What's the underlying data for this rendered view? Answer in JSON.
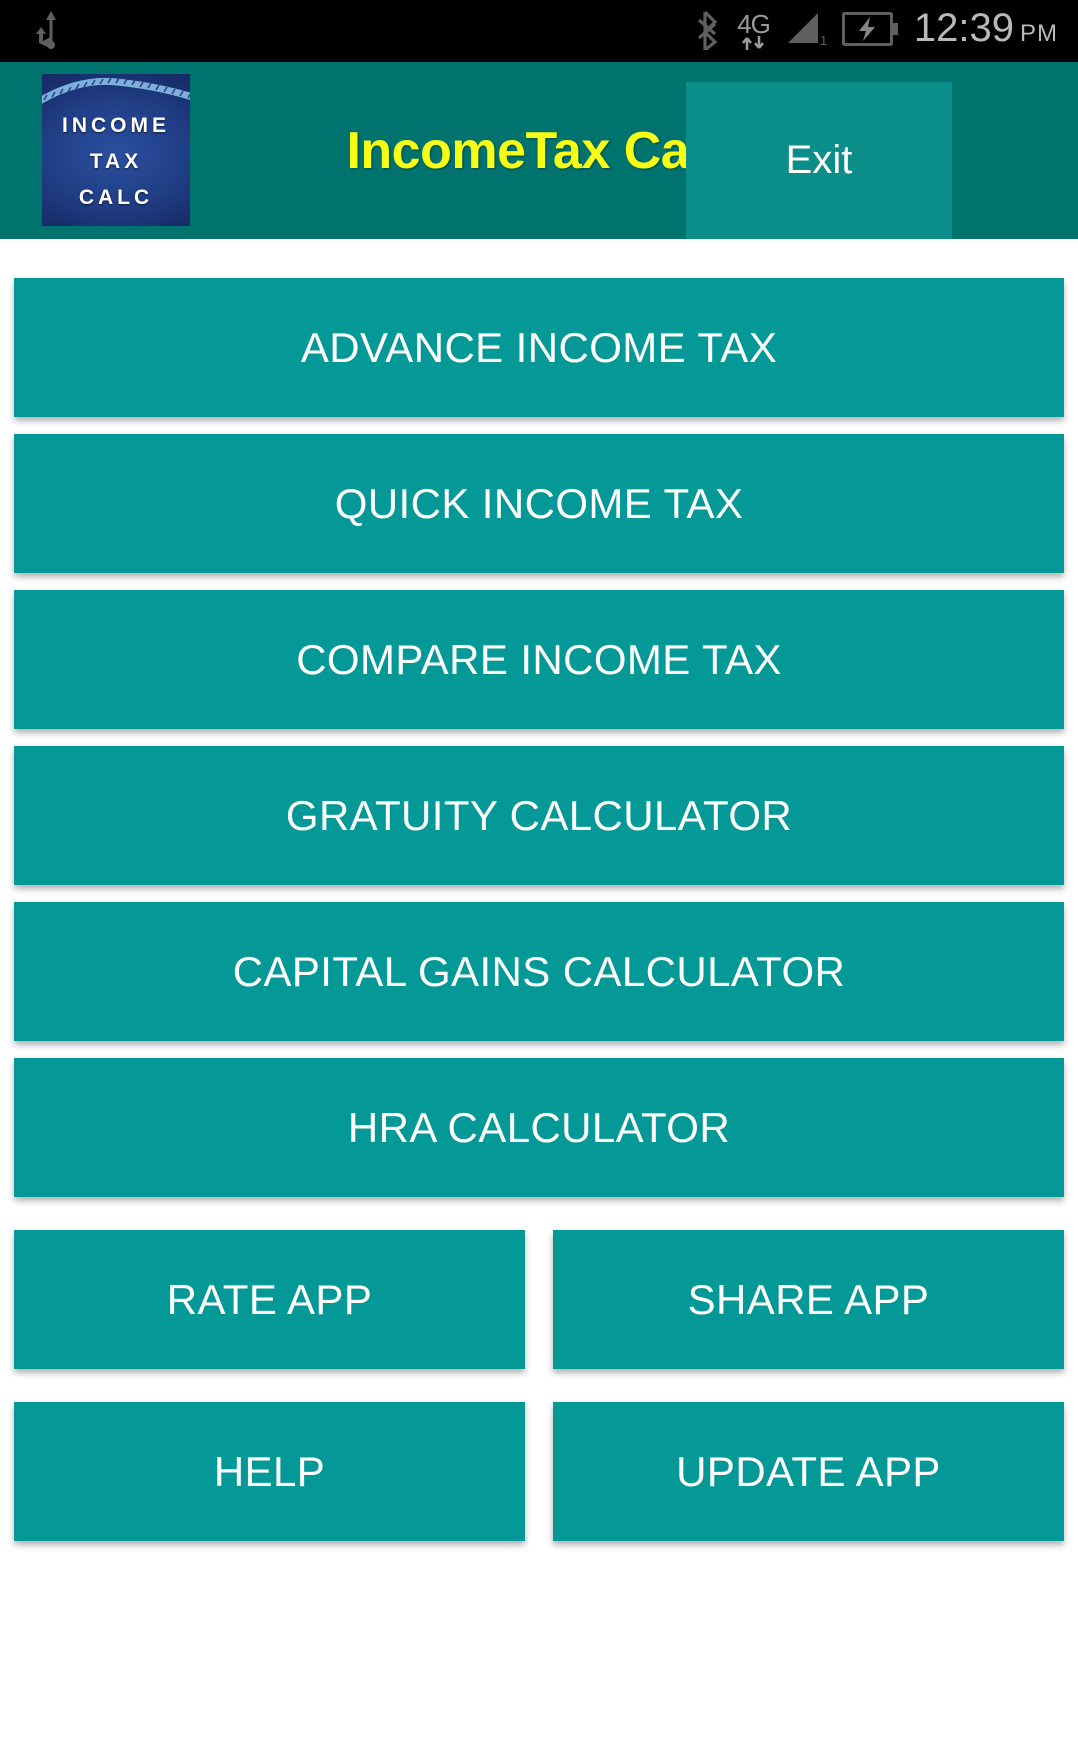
{
  "statusbar": {
    "icons": [
      "usb-icon",
      "bluetooth-icon",
      "mobile-data-icon",
      "signal-icon",
      "battery-charging-icon"
    ],
    "network_label": "4G",
    "signal_bars_label": "1",
    "time": "12:39",
    "ampm": "PM"
  },
  "header": {
    "logo": {
      "line1": "INCOME",
      "line2": "TAX",
      "line3": "CALC"
    },
    "title": "IncomeTax Calc",
    "exit_label": "Exit"
  },
  "main": {
    "primary_buttons": [
      {
        "label": "ADVANCE INCOME TAX"
      },
      {
        "label": "QUICK INCOME TAX"
      },
      {
        "label": "COMPARE INCOME TAX"
      },
      {
        "label": "GRATUITY CALCULATOR"
      },
      {
        "label": "CAPITAL GAINS CALCULATOR"
      },
      {
        "label": "HRA CALCULATOR"
      }
    ],
    "secondary_rows": [
      {
        "left": "RATE APP",
        "right": "SHARE APP"
      },
      {
        "left": "HELP",
        "right": "UPDATE APP"
      }
    ]
  },
  "colors": {
    "header_teal": "#00736E",
    "button_teal": "#049896",
    "exit_teal": "#0B8D8A",
    "title_yellow": "#F7FF17",
    "statusbar_black": "#000000",
    "page_background": "#FFFFFF"
  }
}
